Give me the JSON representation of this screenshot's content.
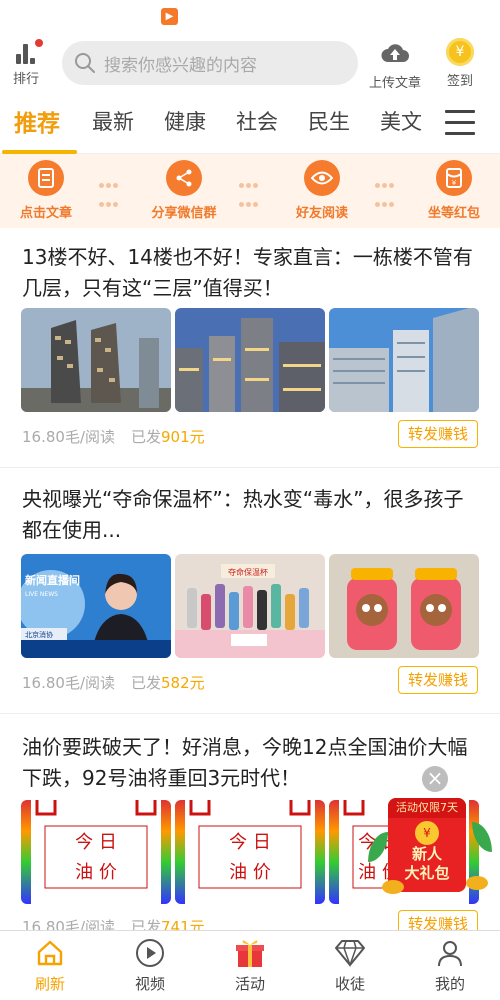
{
  "status": {
    "app_icon": "video-app-icon"
  },
  "header": {
    "rank_label": "排行",
    "search_placeholder": "搜索你感兴趣的内容",
    "upload_label": "上传文章",
    "signin_label": "签到",
    "coin_symbol": "¥"
  },
  "tabs": [
    {
      "label": "推荐",
      "active": true
    },
    {
      "label": "最新"
    },
    {
      "label": "健康"
    },
    {
      "label": "社会"
    },
    {
      "label": "民生"
    },
    {
      "label": "美文"
    }
  ],
  "tasks": [
    {
      "label": "点击文章",
      "icon": "document-icon"
    },
    {
      "label": "分享微信群",
      "icon": "share-icon"
    },
    {
      "label": "好友阅读",
      "icon": "eye-icon"
    },
    {
      "label": "坐等红包",
      "icon": "red-packet-icon"
    }
  ],
  "articles": [
    {
      "title": "13楼不好、14楼也不好！专家直言：一栋楼不管有几层，只有这“三层”值得买！",
      "price": "16.80毛/阅读",
      "earned_prefix": "已发",
      "earned_value": "901元",
      "share_label": "转发赚钱",
      "images": [
        "high-rise-buildings",
        "apartment-towers",
        "glass-skyscrapers"
      ]
    },
    {
      "title": "央视曝光“夺命保温杯”：热水变“毒水”，很多孩子都在使用...",
      "price": "16.80毛/阅读",
      "earned_prefix": "已发",
      "earned_value": "582元",
      "share_label": "转发赚钱",
      "images": [
        "news-anchor",
        "thermos-bottles",
        "kids-thermos-cups"
      ],
      "news_caption": "新闻直播间",
      "news_caption_sub": "LIVE NEWS",
      "news_location": "北京消协",
      "sign_text": "夺命保温杯"
    },
    {
      "title": "油价要跌破天了！好消息，今晚12点全国油价大幅下跌，92号油将重回3元时代！",
      "price": "16.80毛/阅读",
      "earned_prefix": "已发",
      "earned_value": "741元",
      "share_label": "转发赚钱",
      "images": [
        "oil-price-card",
        "oil-price-card",
        "oil-price-card"
      ],
      "card_line1": "今 日",
      "card_line2": "油 价"
    }
  ],
  "promo": {
    "banner": "活动仅限7天",
    "line1": "新人",
    "line2": "大礼包",
    "close_symbol": "×"
  },
  "bottom_nav": [
    {
      "label": "刷新",
      "icon": "home-icon",
      "active": true
    },
    {
      "label": "视频",
      "icon": "play-icon"
    },
    {
      "label": "活动",
      "icon": "gift-icon"
    },
    {
      "label": "收徒",
      "icon": "diamond-icon"
    },
    {
      "label": "我的",
      "icon": "user-icon"
    }
  ],
  "colors": {
    "accent": "#f5a800",
    "task_orange": "#f57b2e",
    "task_bg": "#fff3ea"
  }
}
